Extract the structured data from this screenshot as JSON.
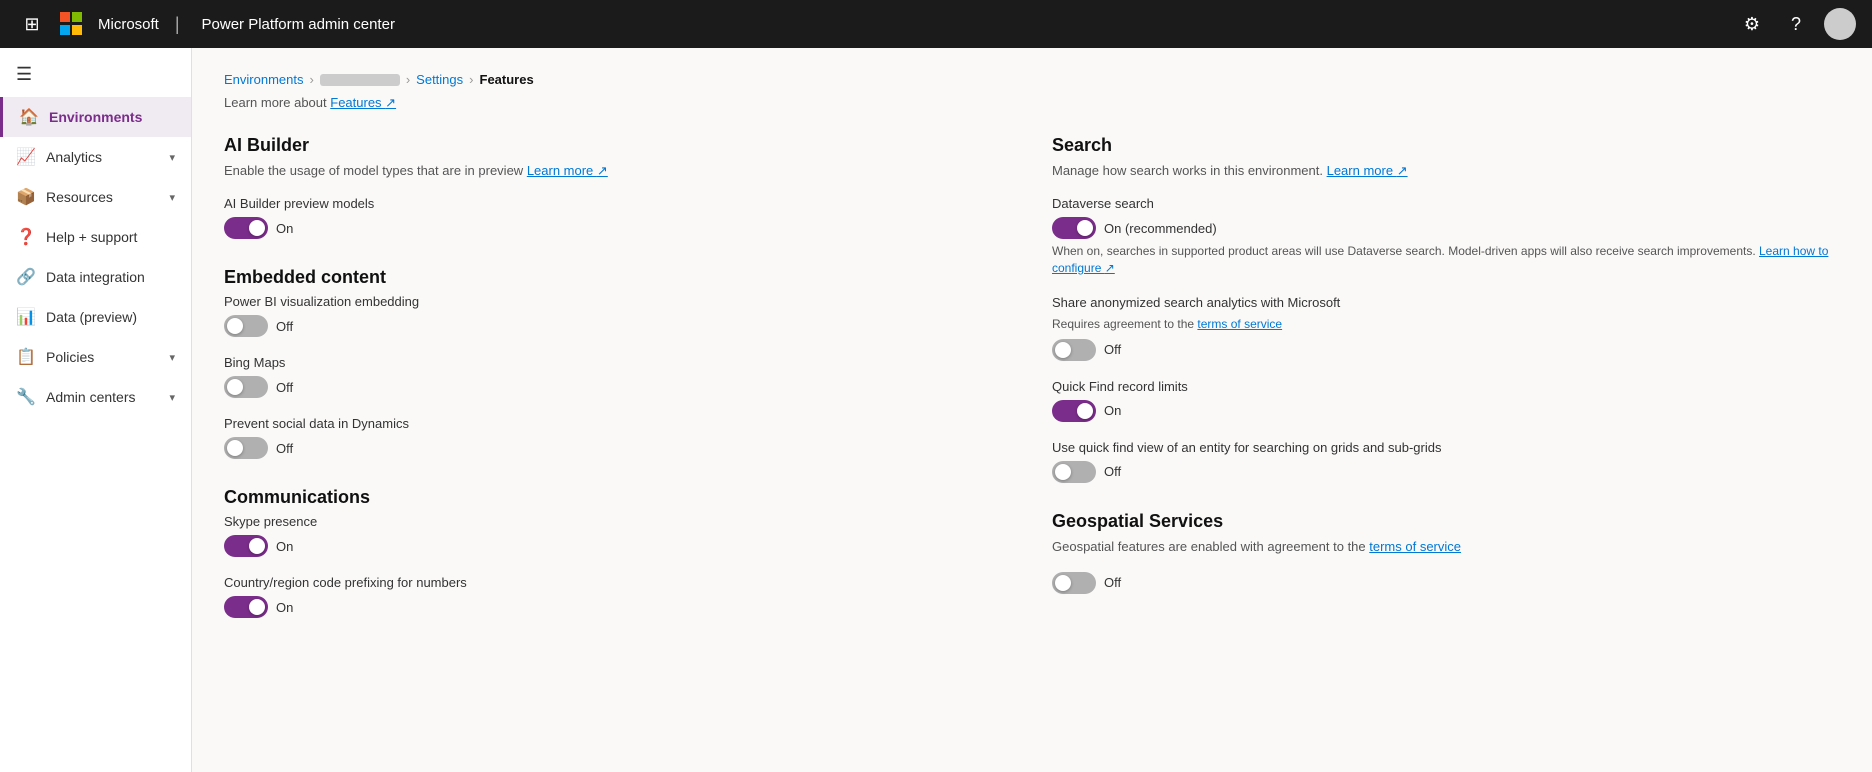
{
  "topbar": {
    "app_name": "Power Platform admin center",
    "waffle_icon": "⊞",
    "gear_icon": "⚙",
    "help_icon": "?"
  },
  "sidebar": {
    "hamburger": "☰",
    "items": [
      {
        "id": "environments",
        "label": "Environments",
        "icon": "🏠",
        "active": true,
        "has_chevron": false
      },
      {
        "id": "analytics",
        "label": "Analytics",
        "icon": "📈",
        "active": false,
        "has_chevron": true
      },
      {
        "id": "resources",
        "label": "Resources",
        "icon": "📦",
        "active": false,
        "has_chevron": true
      },
      {
        "id": "help-support",
        "label": "Help + support",
        "icon": "❓",
        "active": false,
        "has_chevron": false
      },
      {
        "id": "data-integration",
        "label": "Data integration",
        "icon": "🔗",
        "active": false,
        "has_chevron": false
      },
      {
        "id": "data-preview",
        "label": "Data (preview)",
        "icon": "📊",
        "active": false,
        "has_chevron": false
      },
      {
        "id": "policies",
        "label": "Policies",
        "icon": "📋",
        "active": false,
        "has_chevron": true
      },
      {
        "id": "admin-centers",
        "label": "Admin centers",
        "icon": "🔧",
        "active": false,
        "has_chevron": true
      }
    ]
  },
  "breadcrumb": {
    "environments_label": "Environments",
    "settings_label": "Settings",
    "features_label": "Features"
  },
  "learn_more": {
    "prefix": "Learn more about",
    "link_text": "Features",
    "icon": "↗"
  },
  "left_column": {
    "ai_builder": {
      "title": "AI Builder",
      "description_prefix": "Enable the usage of model types that are in preview",
      "learn_more_text": "Learn more",
      "learn_more_icon": "↗",
      "toggles": [
        {
          "id": "ai-builder-preview",
          "label": "AI Builder preview models",
          "state": "on",
          "status_text": "On"
        }
      ]
    },
    "embedded_content": {
      "title": "Embedded content",
      "toggles": [
        {
          "id": "power-bi-embed",
          "label": "Power BI visualization embedding",
          "state": "off",
          "status_text": "Off"
        },
        {
          "id": "bing-maps",
          "label": "Bing Maps",
          "state": "off",
          "status_text": "Off"
        },
        {
          "id": "prevent-social",
          "label": "Prevent social data in Dynamics",
          "state": "off",
          "status_text": "Off"
        }
      ]
    },
    "communications": {
      "title": "Communications",
      "toggles": [
        {
          "id": "skype-presence",
          "label": "Skype presence",
          "state": "on",
          "status_text": "On"
        },
        {
          "id": "country-code",
          "label": "Country/region code prefixing for numbers",
          "state": "on",
          "status_text": "On"
        }
      ]
    }
  },
  "right_column": {
    "search": {
      "title": "Search",
      "description_prefix": "Manage how search works in this environment.",
      "learn_more_text": "Learn more",
      "learn_more_icon": "↗",
      "toggles": [
        {
          "id": "dataverse-search",
          "label": "Dataverse search",
          "state": "on",
          "status_text": "On (recommended)",
          "subdesc": "When on, searches in supported product areas will use Dataverse search. Model-driven apps will also receive search improvements.",
          "subdesc_link_text": "Learn how to configure",
          "subdesc_link_icon": "↗"
        },
        {
          "id": "share-search-analytics",
          "label": "Share anonymized search analytics with Microsoft",
          "sublabel": "Requires agreement to the",
          "sublabel_link": "terms of service",
          "state": "off",
          "status_text": "Off"
        },
        {
          "id": "quick-find-limits",
          "label": "Quick Find record limits",
          "state": "on",
          "status_text": "On"
        },
        {
          "id": "quick-find-view",
          "label": "Use quick find view of an entity for searching on grids and sub-grids",
          "state": "off",
          "status_text": "Off"
        }
      ]
    },
    "geospatial": {
      "title": "Geospatial Services",
      "description_prefix": "Geospatial features are enabled with agreement to the",
      "description_link": "terms of service",
      "toggles": [
        {
          "id": "geospatial",
          "label": "",
          "state": "off",
          "status_text": "Off"
        }
      ]
    }
  }
}
